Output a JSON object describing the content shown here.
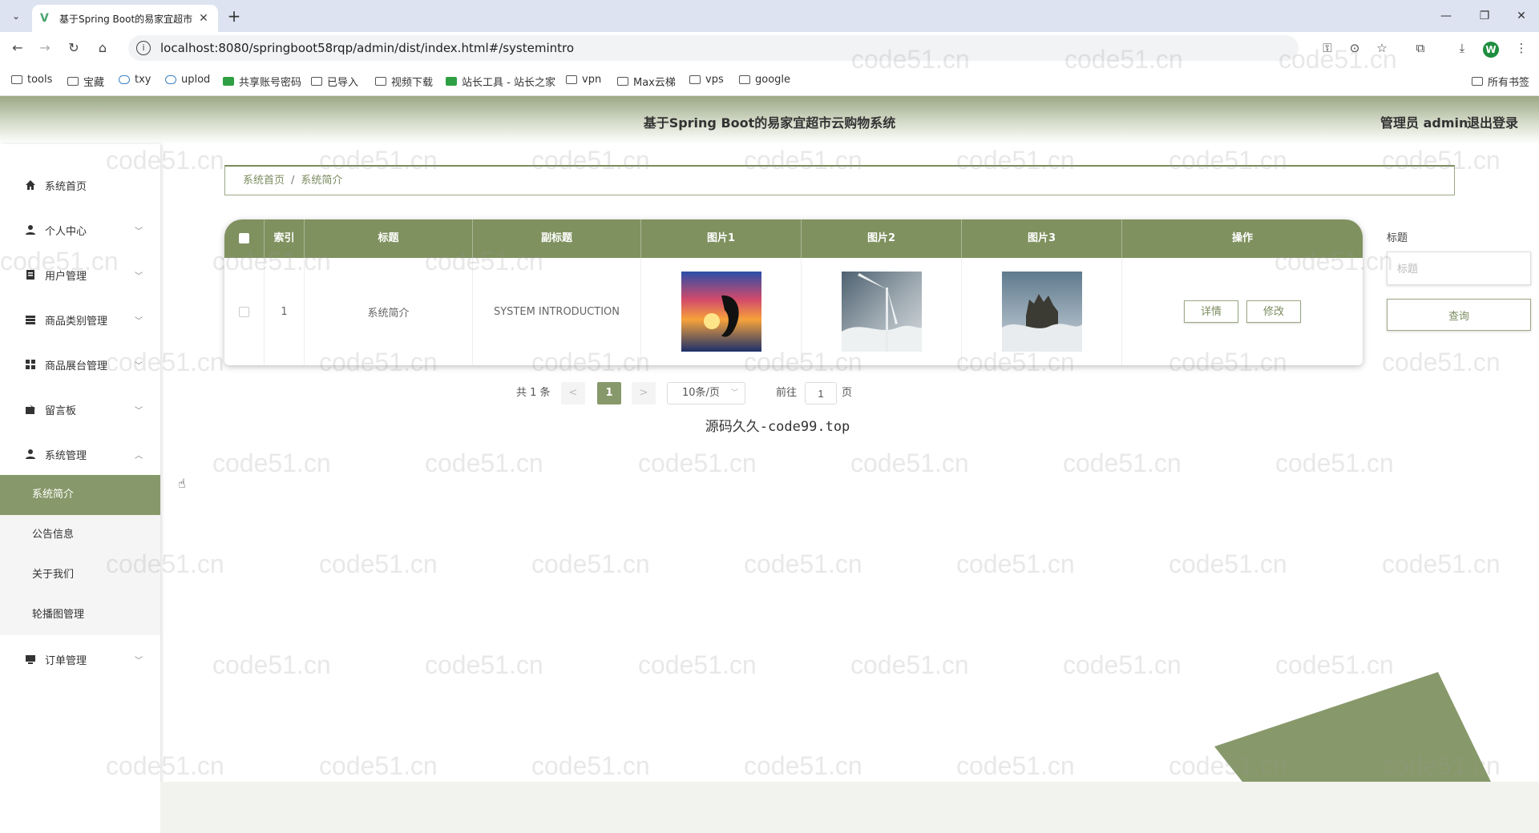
{
  "browser": {
    "tab_title": "基于Spring Boot的易家宜超市",
    "url": "localhost:8080/springboot58rqp/admin/dist/index.html#/systemintro",
    "profile_initial": "W",
    "bookmarks": [
      "tools",
      "宝藏",
      "txy",
      "uplod",
      "共享账号密码",
      "已导入",
      "视频下载",
      "站长工具 - 站长之家",
      "vpn",
      "Max云梯",
      "vps",
      "google"
    ],
    "all_bookmarks": "所有书签"
  },
  "header": {
    "title": "基于Spring Boot的易家宜超市云购物系统",
    "admin_label": "管理员 admin",
    "logout": "退出登录"
  },
  "sidebar": {
    "items": [
      {
        "label": "系统首页",
        "icon": "home-icon"
      },
      {
        "label": "个人中心",
        "icon": "person-icon"
      },
      {
        "label": "用户管理",
        "icon": "list-icon"
      },
      {
        "label": "商品类别管理",
        "icon": "layers-icon"
      },
      {
        "label": "商品展台管理",
        "icon": "grid-icon"
      },
      {
        "label": "留言板",
        "icon": "board-icon"
      },
      {
        "label": "系统管理",
        "icon": "person-icon"
      },
      {
        "label": "订单管理",
        "icon": "monitor-icon"
      }
    ],
    "submenu": [
      "系统简介",
      "公告信息",
      "关于我们",
      "轮播图管理"
    ]
  },
  "breadcrumb": {
    "home": "系统首页",
    "sep": "/",
    "current": "系统简介"
  },
  "table": {
    "headers": [
      "索引",
      "标题",
      "副标题",
      "图片1",
      "图片2",
      "图片3",
      "操作"
    ],
    "rows": [
      {
        "index": "1",
        "title": "系统简介",
        "subtitle": "SYSTEM INTRODUCTION"
      }
    ],
    "detail_btn": "详情",
    "edit_btn": "修改"
  },
  "search": {
    "label": "标题",
    "placeholder": "标题",
    "button": "查询"
  },
  "pagination": {
    "total": "共 1 条",
    "prev": "<",
    "current": "1",
    "next": ">",
    "page_size": "10条/页",
    "goto_label": "前往",
    "goto_value": "1",
    "page_suffix": "页"
  },
  "footer_note": "源码久久-code99.top",
  "watermark": "code51.cn",
  "colors": {
    "accent": "#87996a",
    "header_green": "#7f915f"
  }
}
